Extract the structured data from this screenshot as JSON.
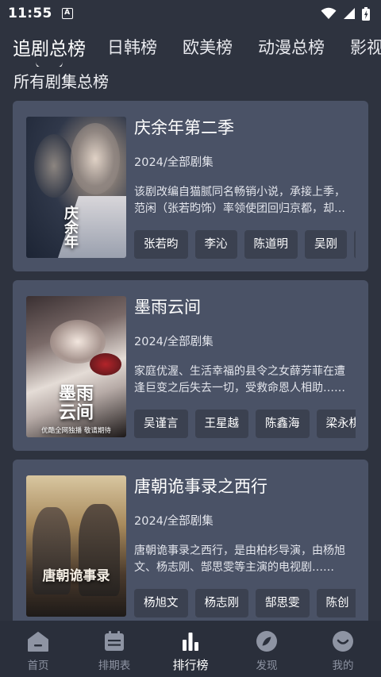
{
  "status_bar": {
    "time": "11:55",
    "notification_icon": "A"
  },
  "tabs": [
    {
      "label": "追剧总榜",
      "active": true
    },
    {
      "label": "日韩榜",
      "active": false
    },
    {
      "label": "欧美榜",
      "active": false
    },
    {
      "label": "动漫总榜",
      "active": false
    },
    {
      "label": "影视",
      "active": false
    }
  ],
  "section_title": "所有剧集总榜",
  "cards": [
    {
      "title": "庆余年第二季",
      "meta": "2024/全部剧集",
      "description": "该剧改编自猫腻同名畅销小说，承接上季，范闲（张若昀饰）率领使团回归京都，却遭遇刺杀……",
      "cast": [
        "张若昀",
        "李沁",
        "陈道明",
        "吴刚",
        ""
      ],
      "poster_text": "庆余年"
    },
    {
      "title": "墨雨云间",
      "meta": "2024/全部剧集",
      "description": "家庭优渥、生活幸福的县令之女薛芳菲在遭逢巨变之后失去一切，受救命恩人相助……",
      "cast": [
        "吴谨言",
        "王星越",
        "陈鑫海",
        "梁永棋"
      ],
      "poster_text": "墨雨\n云间",
      "poster_caption": "优酷全网独播  敬请期待"
    },
    {
      "title": "唐朝诡事录之西行",
      "meta": "2024/全部剧集",
      "description": "唐朝诡事录之西行，是由柏杉导演，由杨旭文、杨志刚、郜思雯等主演的电视剧……",
      "cast": [
        "杨旭文",
        "杨志刚",
        "郜思雯",
        "陈创"
      ],
      "poster_text": "唐朝诡事录"
    }
  ],
  "bottom_nav": [
    {
      "label": "首页",
      "icon": "home-icon",
      "active": false
    },
    {
      "label": "排期表",
      "icon": "calendar-icon",
      "active": false
    },
    {
      "label": "排行榜",
      "icon": "bar-chart-icon",
      "active": true
    },
    {
      "label": "发现",
      "icon": "compass-icon",
      "active": false
    },
    {
      "label": "我的",
      "icon": "smile-face-icon",
      "active": false
    }
  ],
  "colors": {
    "background": "#2e333f",
    "card": "#4a5266",
    "chip": "#3b4150",
    "nav_background": "#2a2f3b",
    "nav_inactive": "#8e94a3",
    "nav_active": "#ffffff"
  }
}
